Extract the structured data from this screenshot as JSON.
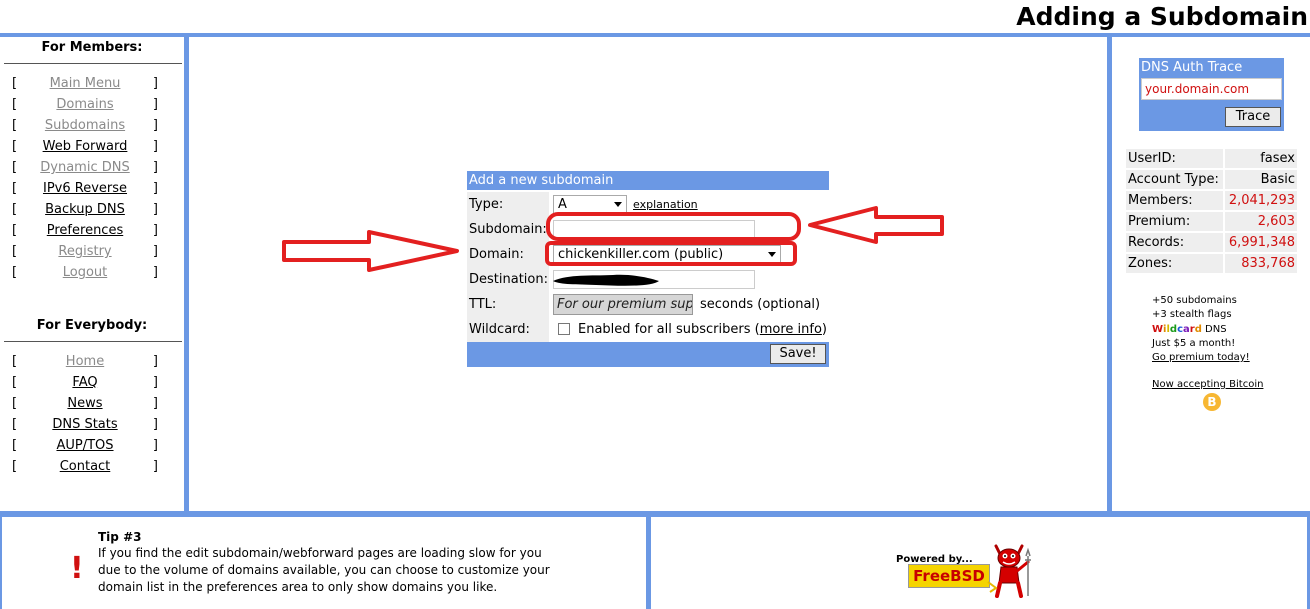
{
  "page": {
    "title": "Adding a Subdomain"
  },
  "members": {
    "heading": "For Members:",
    "items": [
      {
        "label": "Main Menu"
      },
      {
        "label": "Domains"
      },
      {
        "label": "Subdomains"
      },
      {
        "label": "Web Forward"
      },
      {
        "label": "Dynamic DNS"
      },
      {
        "label": "IPv6 Reverse"
      },
      {
        "label": "Backup DNS"
      },
      {
        "label": "Preferences"
      },
      {
        "label": "Registry"
      },
      {
        "label": "Logout"
      }
    ]
  },
  "everybody": {
    "heading": "For Everybody:",
    "items": [
      {
        "label": "Home"
      },
      {
        "label": "FAQ"
      },
      {
        "label": "News"
      },
      {
        "label": "DNS Stats"
      },
      {
        "label": "AUP/TOS"
      },
      {
        "label": "Contact"
      }
    ]
  },
  "form": {
    "header": "Add a new subdomain",
    "type_label": "Type:",
    "type_value": "A",
    "explanation_link": "explanation",
    "subdomain_label": "Subdomain:",
    "subdomain_value": "",
    "domain_label": "Domain:",
    "domain_value": "chickenkiller.com (public)",
    "destination_label": "Destination:",
    "ttl_label": "TTL:",
    "ttl_placeholder": "For our premium supporters",
    "ttl_suffix": "seconds (optional)",
    "wildcard_label": "Wildcard:",
    "wildcard_text": "Enabled for all subscribers (",
    "wildcard_link": "more info",
    "wildcard_close": ")",
    "save_button": "Save!"
  },
  "dns_trace": {
    "title": "DNS Auth Trace",
    "input_value": "your.domain.com",
    "button": "Trace"
  },
  "stats": {
    "rows": [
      {
        "label": "UserID:",
        "value": "fasex"
      },
      {
        "label": "Account Type:",
        "value": "Basic"
      },
      {
        "label": "Members:",
        "value": "2,041,293"
      },
      {
        "label": "Premium:",
        "value": "2,603"
      },
      {
        "label": "Records:",
        "value": "6,991,348"
      },
      {
        "label": "Zones:",
        "value": "833,768"
      }
    ]
  },
  "promo": {
    "line1": "+50 subdomains",
    "line2": "+3 stealth flags",
    "wildcard_word": "Wildcard",
    "line3_suffix": " DNS",
    "line4": "Just $5 a month!",
    "premium_link": "Go premium today!",
    "bitcoin_link": "Now accepting Bitcoin",
    "bitcoin_icon": "B"
  },
  "tip": {
    "icon": "!",
    "title": "Tip #3",
    "body": "If you find the edit subdomain/webforward pages are loading slow for you due to the volume of domains available, you can choose to customize your domain list in the preferences area to only show domains you like."
  },
  "footer": {
    "powered_by": "Powered by...",
    "freebsd": "FreeBSD"
  },
  "colors": {
    "frame_blue": "#6b98e4",
    "annotation_red": "#e32020",
    "stat_red": "#d01010",
    "label_gray": "#eeeeee"
  },
  "icons": [
    "bitcoin-icon",
    "freebsd-daemon-icon",
    "exclamation-icon",
    "arrow-right-icon",
    "arrow-left-icon",
    "dropdown-caret-icon"
  ]
}
